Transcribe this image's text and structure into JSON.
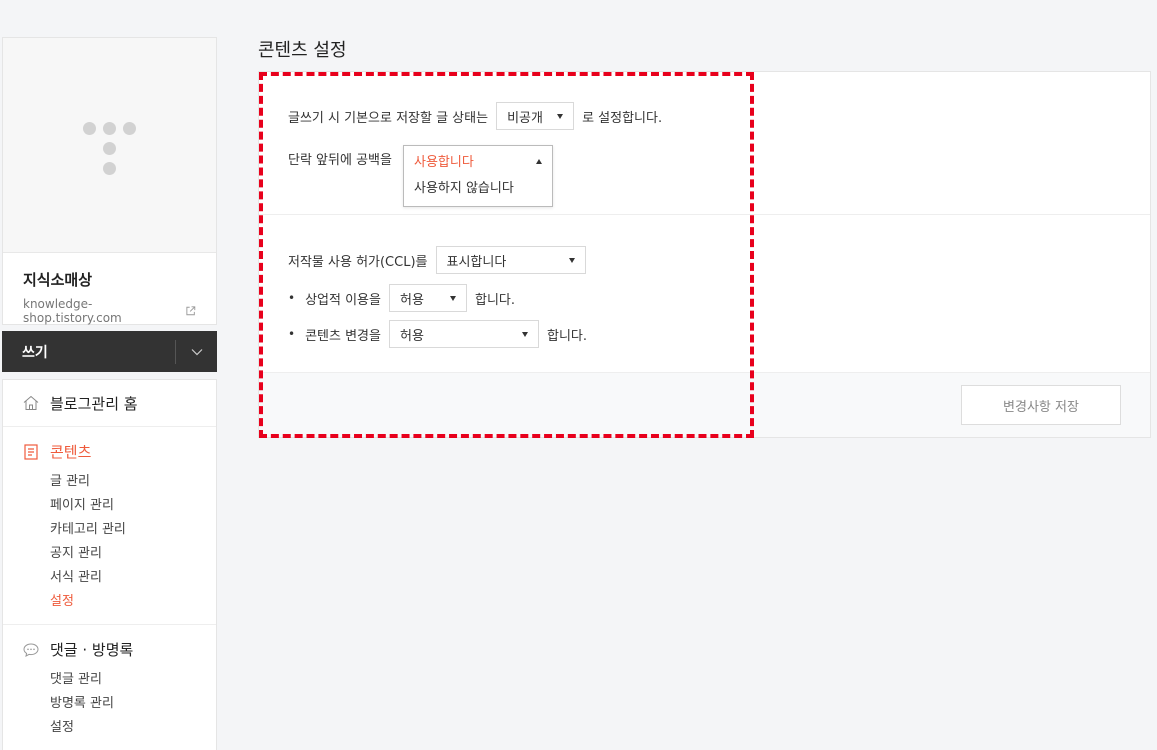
{
  "sidebar": {
    "blog_name": "지식소매상",
    "blog_url": "knowledge-shop.tistory.com",
    "write_label": "쓰기",
    "home_label": "블로그관리 홈",
    "content": {
      "title": "콘텐츠",
      "items": [
        "글 관리",
        "페이지 관리",
        "카테고리 관리",
        "공지 관리",
        "서식 관리",
        "설정"
      ]
    },
    "comments": {
      "title": "댓글 · 방명록",
      "items": [
        "댓글 관리",
        "방명록 관리",
        "설정"
      ]
    }
  },
  "main": {
    "page_title": "콘텐츠 설정",
    "default_status": {
      "prefix": "글쓰기 시 기본으로 저장할 글 상태는",
      "value": "비공개",
      "suffix": "로 설정합니다."
    },
    "paragraph_spacing": {
      "label": "단락 앞뒤에 공백을",
      "options": [
        "사용합니다",
        "사용하지 않습니다"
      ]
    },
    "ccl": {
      "label": "저작물 사용 허가(CCL)를",
      "value": "표시합니다"
    },
    "commercial": {
      "bullet": "•",
      "label": "상업적 이용을",
      "value": "허용",
      "suffix": "합니다."
    },
    "modify": {
      "bullet": "•",
      "label": "콘텐츠 변경을",
      "value": "허용",
      "suffix": "합니다."
    },
    "save_label": "변경사항 저장"
  },
  "colors": {
    "accent": "#ef5b3c",
    "highlight": "#e8001c",
    "dark_bar": "#333333"
  }
}
